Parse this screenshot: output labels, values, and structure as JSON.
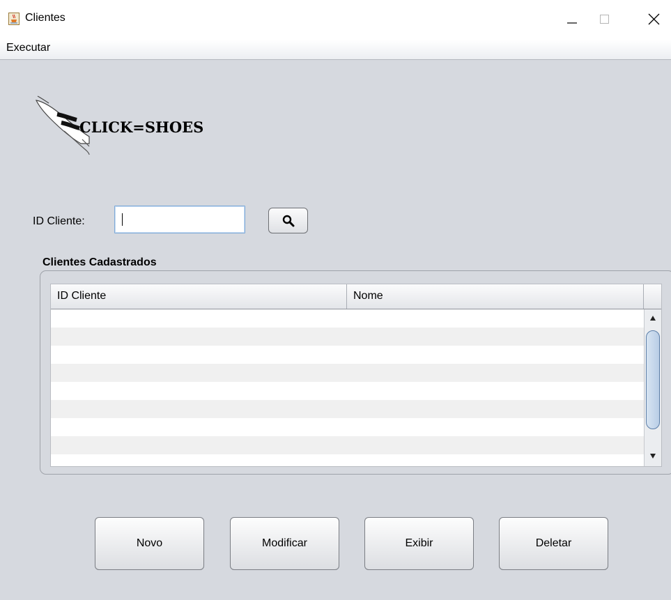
{
  "window": {
    "title": "Clientes",
    "icon": "java-cup-icon"
  },
  "menubar": {
    "items": [
      {
        "label": "Executar"
      }
    ]
  },
  "logo": {
    "text": "CLICK=SHOES",
    "icon": "sneaker-icon"
  },
  "search": {
    "label": "ID Cliente:",
    "value": "",
    "button_icon": "magnifier-icon"
  },
  "panel": {
    "title": "Clientes Cadastrados",
    "columns": [
      "ID Cliente",
      "Nome"
    ],
    "rows": []
  },
  "buttons": {
    "novo": "Novo",
    "modificar": "Modificar",
    "exibir": "Exibir",
    "deletar": "Deletar"
  },
  "colors": {
    "background": "#d6d9df",
    "alt_row": "#f0f0f0",
    "scroll_thumb": "#b9cde6"
  }
}
